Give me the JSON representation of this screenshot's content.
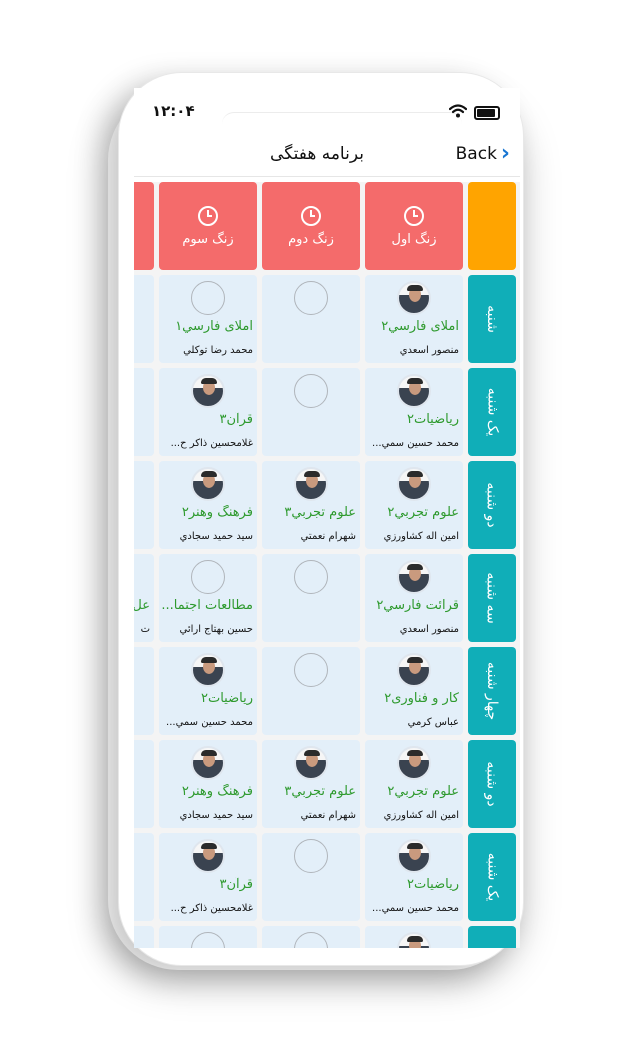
{
  "status": {
    "time": "۱۲:۰۴"
  },
  "nav": {
    "title": "برنامه هفتگی",
    "back_label": "Back"
  },
  "headers": [
    {
      "label": "زنگ اول"
    },
    {
      "label": "زنگ دوم"
    },
    {
      "label": "زنگ سوم"
    },
    {
      "label": ""
    }
  ],
  "days": [
    {
      "label": "شنبه"
    },
    {
      "label": "یک شنبه"
    },
    {
      "label": "دو شنبه"
    },
    {
      "label": "سه شنبه"
    },
    {
      "label": "چهار شنبه"
    },
    {
      "label": "دو شنبه"
    },
    {
      "label": "یک شنبه"
    },
    {
      "label": ""
    }
  ],
  "rows": [
    [
      {
        "has_teacher": true,
        "subject": "املای فارسي۲",
        "teacher": "منصور اسعدي"
      },
      {
        "has_teacher": false,
        "subject": "",
        "teacher": ""
      },
      {
        "has_teacher": false,
        "subject": "املای فارسي۱",
        "teacher": "محمد رضا  توكلي"
      },
      {
        "has_teacher": false,
        "subject": "",
        "teacher": ""
      }
    ],
    [
      {
        "has_teacher": true,
        "subject": "رياضيات۲",
        "teacher": "محمد حسين  سمي..."
      },
      {
        "has_teacher": false,
        "subject": "",
        "teacher": ""
      },
      {
        "has_teacher": true,
        "subject": "قرآن۳",
        "teacher": "غلامحسين ذاكر ح..."
      },
      {
        "has_teacher": false,
        "subject": "",
        "teacher": ""
      }
    ],
    [
      {
        "has_teacher": true,
        "subject": "علوم تجربي۲",
        "teacher": "امين اله كشاورزي"
      },
      {
        "has_teacher": true,
        "subject": "علوم تجربي۳",
        "teacher": "شهرام  نعمتي"
      },
      {
        "has_teacher": true,
        "subject": "فرهنگ وهنر۲",
        "teacher": "سيد حميد  سجادي"
      },
      {
        "has_teacher": false,
        "subject": "",
        "teacher": ""
      }
    ],
    [
      {
        "has_teacher": true,
        "subject": "قرائت فارسي۲",
        "teacher": "منصور اسعدي"
      },
      {
        "has_teacher": false,
        "subject": "",
        "teacher": ""
      },
      {
        "has_teacher": false,
        "subject": "مطالعات اجتما...",
        "teacher": "حسين  بهتاج آرائي"
      },
      {
        "has_teacher": false,
        "subject": "عل",
        "teacher": "ت"
      }
    ],
    [
      {
        "has_teacher": true,
        "subject": "كار و فناوری۲",
        "teacher": "عباس كرمي"
      },
      {
        "has_teacher": false,
        "subject": "",
        "teacher": ""
      },
      {
        "has_teacher": true,
        "subject": "رياضيات۲",
        "teacher": "محمد حسين  سمي..."
      },
      {
        "has_teacher": false,
        "subject": "",
        "teacher": ""
      }
    ],
    [
      {
        "has_teacher": true,
        "subject": "علوم تجربي۲",
        "teacher": "امين اله كشاورزي"
      },
      {
        "has_teacher": true,
        "subject": "علوم تجربي۳",
        "teacher": "شهرام  نعمتي"
      },
      {
        "has_teacher": true,
        "subject": "فرهنگ وهنر۲",
        "teacher": "سيد حميد  سجادي"
      },
      {
        "has_teacher": false,
        "subject": "",
        "teacher": ""
      }
    ],
    [
      {
        "has_teacher": true,
        "subject": "رياضيات۲",
        "teacher": "محمد حسين  سمي..."
      },
      {
        "has_teacher": false,
        "subject": "",
        "teacher": ""
      },
      {
        "has_teacher": true,
        "subject": "قرآن۳",
        "teacher": "غلامحسين ذاكر ح..."
      },
      {
        "has_teacher": false,
        "subject": "",
        "teacher": ""
      }
    ],
    [
      {
        "has_teacher": true,
        "subject": "",
        "teacher": ""
      },
      {
        "has_teacher": false,
        "subject": "",
        "teacher": ""
      },
      {
        "has_teacher": false,
        "subject": "",
        "teacher": ""
      },
      {
        "has_teacher": false,
        "subject": "",
        "teacher": ""
      }
    ]
  ]
}
